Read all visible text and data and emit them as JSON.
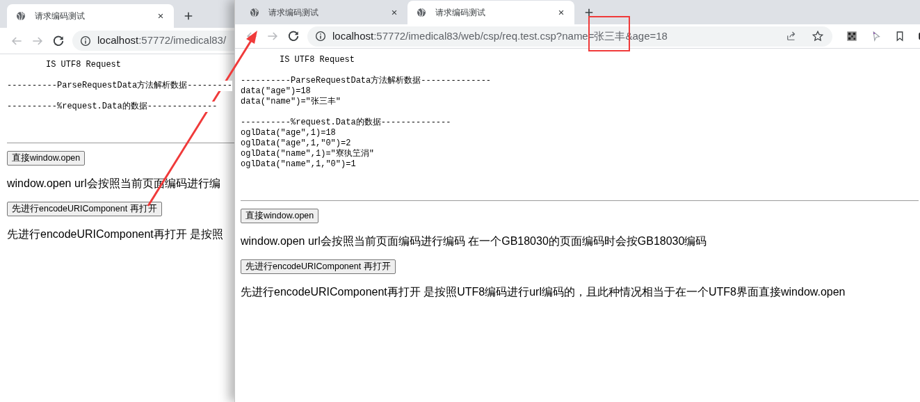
{
  "windows": [
    {
      "tabs": [
        {
          "title": "请求编码测试",
          "selected": true
        }
      ],
      "nav": {
        "back_disabled": true,
        "forward_disabled": true
      },
      "address": {
        "host": "localhost",
        "rest": ":57772/imedical83/"
      },
      "toolbar_extras": false,
      "pre_blocks": [
        {
          "kind": "header",
          "lines": [
            "IS UTF8 Request"
          ]
        },
        {
          "kind": "data",
          "lines": [
            "----------ParseRequestData方法解析数据---------"
          ]
        },
        {
          "kind": "data",
          "lines": [
            "----------%request.Data的数据--------------"
          ]
        }
      ],
      "items": [
        {
          "kind": "button",
          "text": "直接window.open"
        },
        {
          "kind": "paragraph",
          "text": "window.open url会按照当前页面编码进行编"
        },
        {
          "kind": "button",
          "text": "先进行encodeURIComponent 再打开"
        },
        {
          "kind": "paragraph",
          "text": "先进行encodeURIComponent再打开 是按照"
        }
      ]
    },
    {
      "tabs": [
        {
          "title": "请求编码测试",
          "selected": false
        },
        {
          "title": "请求编码测试",
          "selected": true
        }
      ],
      "nav": {
        "back_disabled": true,
        "forward_disabled": true
      },
      "address": {
        "host": "localhost",
        "rest": ":57772/imedical83/web/csp/req.test.csp?name=张三丰&age=18"
      },
      "toolbar_extras": true,
      "pre_blocks": [
        {
          "kind": "header",
          "lines": [
            "IS UTF8 Request"
          ]
        },
        {
          "kind": "data",
          "lines": [
            "----------ParseRequestData方法解析数据--------------",
            "data(\"age\")=18",
            "data(\"name\")=\"张三丰\""
          ]
        },
        {
          "kind": "data",
          "lines": [
            "----------%request.Data的数据--------------",
            "oglData(\"age\",1)=18",
            "oglData(\"age\",1,\"0\")=2",
            "oglData(\"name\",1)=\"寮犱笁涓\"",
            "oglData(\"name\",1,\"0\")=1"
          ]
        }
      ],
      "items": [
        {
          "kind": "button",
          "text": "直接window.open"
        },
        {
          "kind": "paragraph",
          "text": "window.open url会按照当前页面编码进行编码 在一个GB18030的页面编码时会按GB18030编码"
        },
        {
          "kind": "button",
          "text": "先进行encodeURIComponent 再打开"
        },
        {
          "kind": "paragraph",
          "text": "先进行encodeURIComponent再打开 是按照UTF8编码进行url编码的，且此种情况相当于在一个UTF8界面直接window.open"
        }
      ]
    }
  ]
}
